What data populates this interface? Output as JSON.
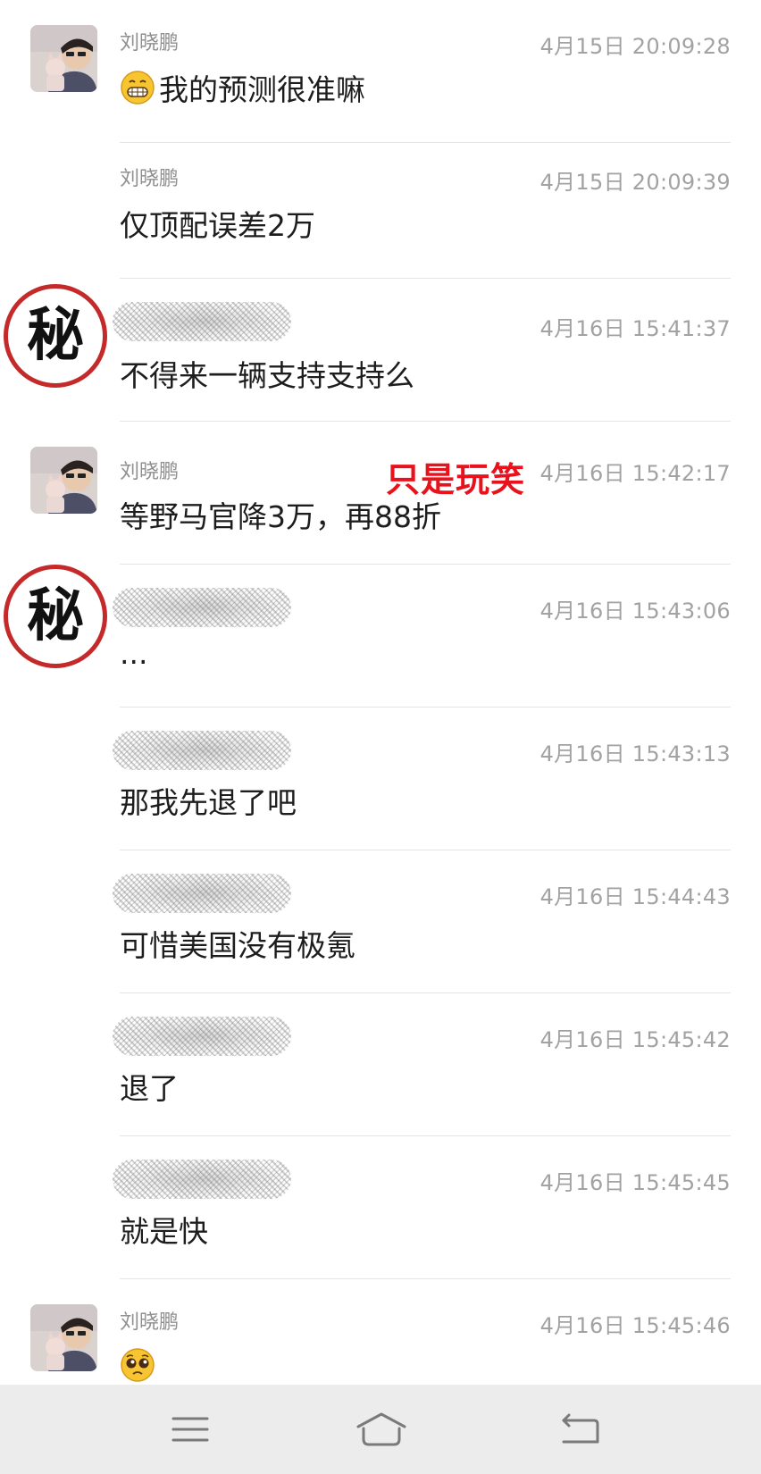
{
  "messages": [
    {
      "sender": "刘晓鹏",
      "time": "4月15日 20:09:28",
      "text": "我的预测很准嘛",
      "emoji": "grin-emoji"
    },
    {
      "sender": "刘晓鹏",
      "time": "4月15日 20:09:39",
      "text": "仅顶配误差2万"
    },
    {
      "sender": "",
      "time": "4月16日 15:41:37",
      "text": "不得来一辆支持支持么",
      "avatar": "秘"
    },
    {
      "sender": "刘晓鹏",
      "time": "4月16日 15:42:17",
      "text": "等野马官降3万，再88折"
    },
    {
      "sender": "",
      "time": "4月16日 15:43:06",
      "text": "...",
      "avatar": "秘"
    },
    {
      "sender": "",
      "time": "4月16日 15:43:13",
      "text": "那我先退了吧"
    },
    {
      "sender": "",
      "time": "4月16日 15:44:43",
      "text": "可惜美国没有极氪"
    },
    {
      "sender": "",
      "time": "4月16日 15:45:42",
      "text": "退了"
    },
    {
      "sender": "",
      "time": "4月16日 15:45:45",
      "text": "就是快"
    },
    {
      "sender": "刘晓鹏",
      "time": "4月16日 15:45:46",
      "text": "",
      "emoji": "pleading-emoji"
    }
  ],
  "annotation": "只是玩笑",
  "navbar": {
    "menu_icon": "menu-icon",
    "home_icon": "home-icon",
    "back_icon": "back-icon",
    "background": "#ececec"
  },
  "colors": {
    "name": "#8f8f8f",
    "time": "#a2a2a2",
    "text": "#1d1d1d",
    "annotation": "#e8121c",
    "secret_border": "#c42a2a"
  }
}
